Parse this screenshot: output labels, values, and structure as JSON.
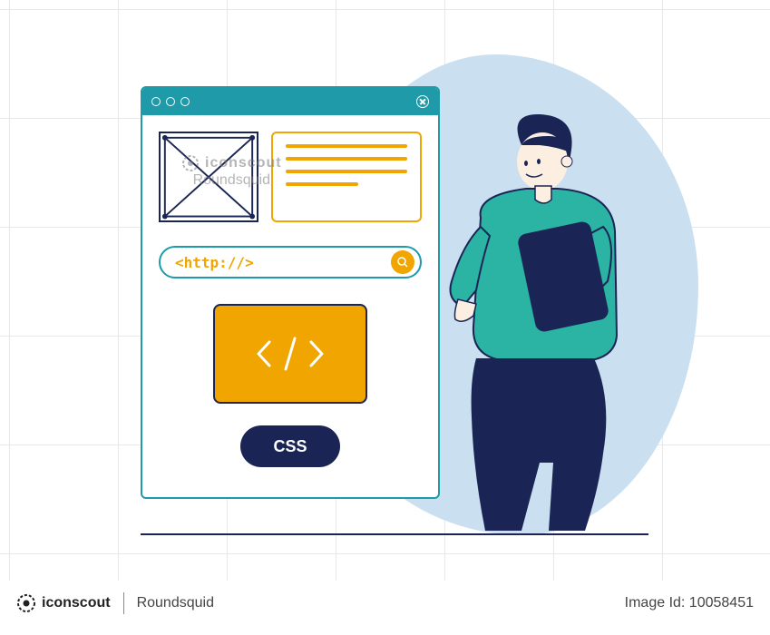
{
  "watermark": {
    "brand": "iconscout",
    "author": "Roundsquid"
  },
  "window": {
    "url_text": "<http://>",
    "css_label": "CSS"
  },
  "footer": {
    "brand": "iconscout",
    "author": "Roundsquid",
    "image_id_label": "Image Id: 10058451"
  }
}
